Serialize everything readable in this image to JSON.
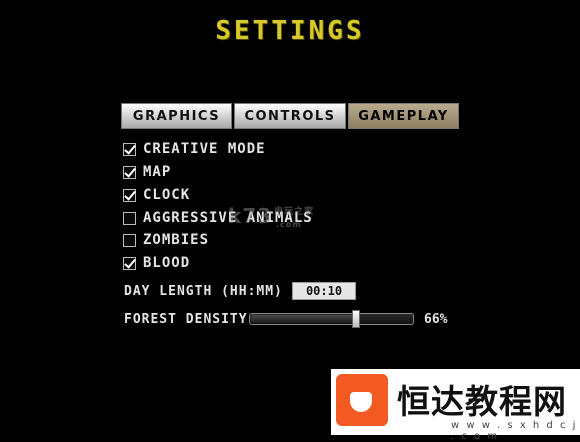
{
  "title": "SETTINGS",
  "tabs": [
    {
      "label": "GRAPHICS",
      "active": false
    },
    {
      "label": "CONTROLS",
      "active": false
    },
    {
      "label": "GAMEPLAY",
      "active": true
    }
  ],
  "options": [
    {
      "label": "CREATIVE MODE",
      "checked": true
    },
    {
      "label": "MAP",
      "checked": true
    },
    {
      "label": "CLOCK",
      "checked": true
    },
    {
      "label": "AGGRESSIVE ANIMALS",
      "checked": false
    },
    {
      "label": "ZOMBIES",
      "checked": false
    },
    {
      "label": "BLOOD",
      "checked": true
    }
  ],
  "day_length": {
    "label": "DAY LENGTH (HH:MM)",
    "value": "00:10"
  },
  "forest_density": {
    "label": "FOREST DENSITY",
    "value_text": "66%",
    "value": 0.66
  },
  "colors": {
    "title": "#d7c92c",
    "active_tab": "#a09070",
    "background": "#000000"
  },
  "watermarks": {
    "k73_text": "k73",
    "k73_cn": "电玩之家",
    "k73_com": ".com",
    "brand_cn": "恒达教程网",
    "brand_url": "w w w . s x h d c j . c o m"
  }
}
